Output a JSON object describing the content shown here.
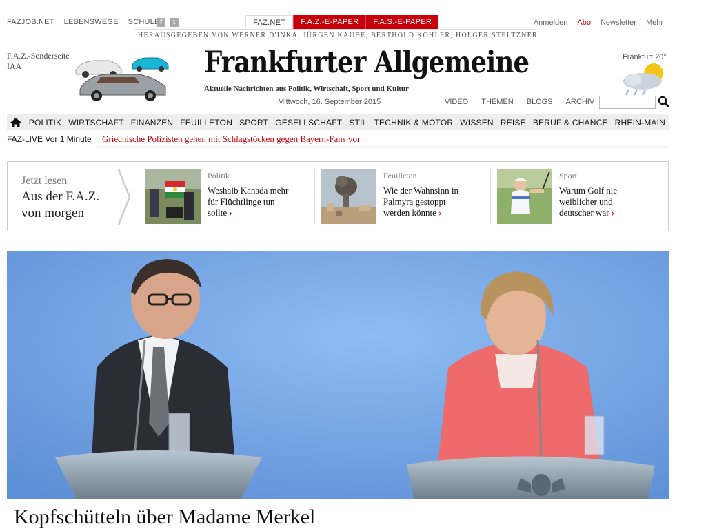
{
  "topbar": {
    "links": [
      "FAZJOB.NET",
      "LEBENSWEGE",
      "SCHULE"
    ],
    "tabs": [
      "FAZ.NET",
      "F.A.Z.-E-PAPER",
      "F.A.S.-E-PAPER"
    ],
    "right_links": [
      "Anmelden",
      "Abo",
      "Newsletter",
      "Mehr"
    ],
    "editors": "HERAUSGEGEBEN VON WERNER D'INKA, JÜRGEN KAUBE, BERTHOLD KOHLER, HOLGER STELTZNER"
  },
  "header": {
    "sonderseite_line1": "F.A.Z.-Sonderseite",
    "sonderseite_line2": "IAA",
    "logo": "Frankfurter Allgemeine",
    "tagline": "Aktuelle Nachrichten aus Politik, Wirtschaft, Sport und Kultur",
    "date": "Mittwoch, 16. September 2015",
    "weather": "Frankfurt 20°",
    "subnav": [
      "VIDEO",
      "THEMEN",
      "BLOGS",
      "ARCHIV"
    ],
    "search_placeholder": ""
  },
  "nav": {
    "items": [
      "POLITIK",
      "WIRTSCHAFT",
      "FINANZEN",
      "FEUILLETON",
      "SPORT",
      "GESELLSCHAFT",
      "STIL",
      "TECHNIK & MOTOR",
      "WISSEN",
      "REISE",
      "BERUF & CHANCE",
      "RHEIN-MAIN"
    ]
  },
  "live": {
    "label": "FAZ-LIVE",
    "time": "Vor 1 Minute",
    "headline": "Griechische Polizisten gehen mit Schlagstöcken gegen Bayern-Fans vor"
  },
  "teaser": {
    "jetzt": "Jetzt lesen",
    "aus_line1": "Aus der F.A.Z.",
    "aus_line2": "von morgen",
    "items": [
      {
        "category": "Politik",
        "line1": "Weshalb Kanada mehr",
        "line2": "für Flüchtlinge tun",
        "line3": "sollte"
      },
      {
        "category": "Feuilleton",
        "line1": "Wie der Wahnsinn in",
        "line2": "Palmyra gestoppt",
        "line3": "werden könnte"
      },
      {
        "category": "Sport",
        "line1": "Warum Golf nie",
        "line2": "weiblicher und",
        "line3": "deutscher war"
      }
    ]
  },
  "hero": {
    "headline": "Kopfschütteln über Madame Merkel"
  },
  "colors": {
    "accent_red": "#c8000a",
    "nav_bg": "#eeeeee",
    "hero_bg": "#6fa3e4"
  }
}
